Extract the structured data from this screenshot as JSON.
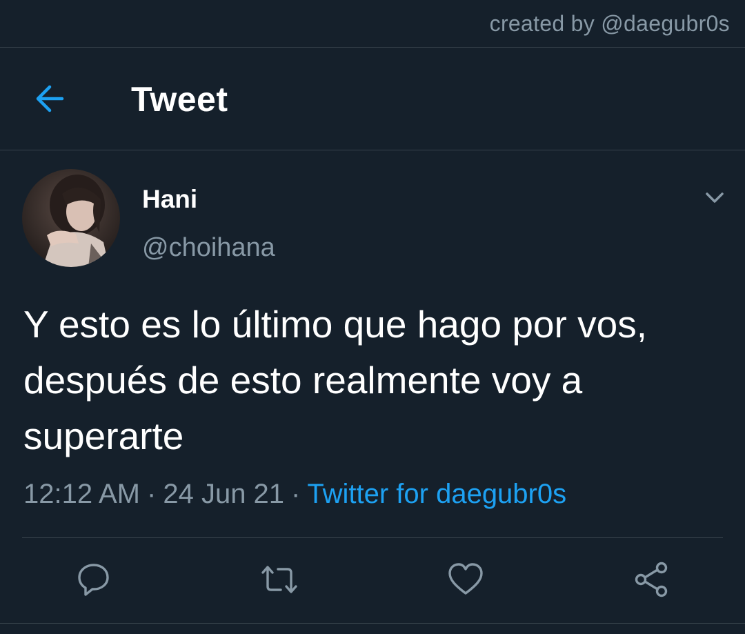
{
  "credit": "created by @daegubr0s",
  "header": {
    "title": "Tweet",
    "back_icon": "arrow-left-icon"
  },
  "tweet": {
    "display_name": "Hani",
    "handle": "@choihana",
    "text": "Y esto es lo último que hago por vos, después de esto realmente voy a superarte",
    "time": "12:12 AM",
    "date": "24 Jun 21",
    "separator": "·",
    "source": "Twitter for daegubr0s"
  },
  "actions": [
    {
      "name": "reply",
      "icon": "speech-bubble-icon"
    },
    {
      "name": "retweet",
      "icon": "retweet-arrows-icon"
    },
    {
      "name": "like",
      "icon": "heart-icon"
    },
    {
      "name": "share",
      "icon": "share-nodes-icon"
    }
  ],
  "colors": {
    "background": "#15202b",
    "border": "#38444d",
    "secondary_text": "#8899a6",
    "accent": "#1da1f2",
    "primary_text": "#ffffff"
  }
}
